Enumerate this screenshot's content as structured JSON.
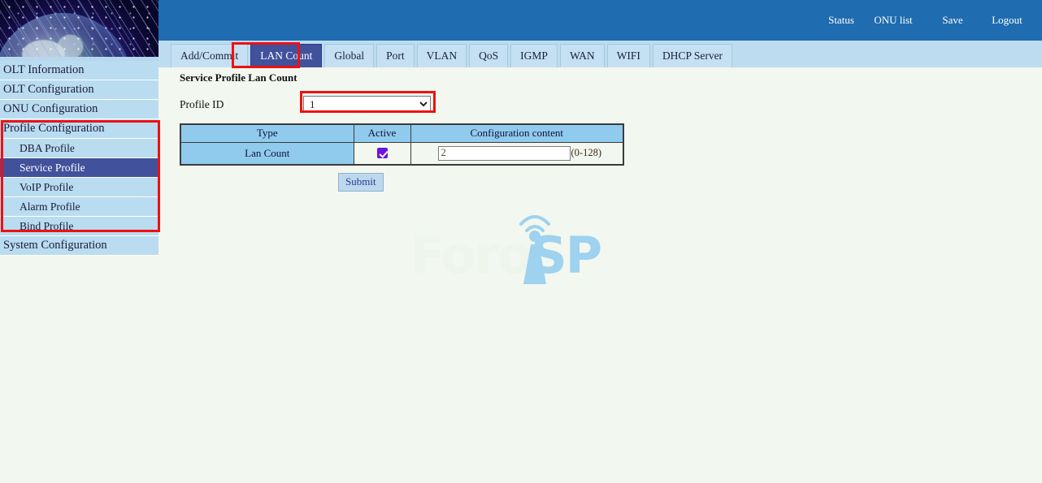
{
  "sidebar": {
    "banner_alt": "globe-fiber-banner",
    "items": [
      {
        "label": "OLT Information",
        "level": "top",
        "active": false
      },
      {
        "label": "OLT Configuration",
        "level": "top",
        "active": false
      },
      {
        "label": "ONU Configuration",
        "level": "top",
        "active": false
      },
      {
        "label": "Profile Configuration",
        "level": "top",
        "active": false
      },
      {
        "label": "DBA Profile",
        "level": "sub",
        "active": false
      },
      {
        "label": "Service Profile",
        "level": "sub",
        "active": true
      },
      {
        "label": "VoIP Profile",
        "level": "sub",
        "active": false
      },
      {
        "label": "Alarm Profile",
        "level": "sub",
        "active": false
      },
      {
        "label": "Bind Profile",
        "level": "sub",
        "active": false
      },
      {
        "label": "System Configuration",
        "level": "top",
        "active": false
      }
    ]
  },
  "topnav": {
    "items": [
      {
        "label": "Status"
      },
      {
        "label": "ONU list"
      },
      {
        "label": "Save"
      },
      {
        "label": "Logout"
      }
    ]
  },
  "tabs": [
    {
      "label": "Add/Commit",
      "active": false
    },
    {
      "label": "LAN Count",
      "active": true
    },
    {
      "label": "Global",
      "active": false
    },
    {
      "label": "Port",
      "active": false
    },
    {
      "label": "VLAN",
      "active": false
    },
    {
      "label": "QoS",
      "active": false
    },
    {
      "label": "IGMP",
      "active": false
    },
    {
      "label": "WAN",
      "active": false
    },
    {
      "label": "WIFI",
      "active": false
    },
    {
      "label": "DHCP Server",
      "active": false
    }
  ],
  "main": {
    "page_title": "Service Profile Lan Count",
    "profile_id_label": "Profile ID",
    "profile_id_value": "1",
    "profile_id_options": [
      "1"
    ],
    "table": {
      "headers": [
        "Type",
        "Active",
        "Configuration content"
      ],
      "rows": [
        {
          "type": "Lan Count",
          "active_checked": true,
          "value": "2",
          "range_hint": "(0-128)"
        }
      ]
    },
    "submit_label": "Submit"
  },
  "watermark": {
    "text_left": "Foro",
    "text_right": "SP",
    "tower_letter": "i"
  },
  "colors": {
    "header_blue": "#1f6cb0",
    "tabbar_blue": "#bddcf0",
    "active_navy": "#41519c",
    "sidebar_blue": "#badcf0",
    "table_header_blue": "#90cbee",
    "page_bg": "#f2f7ef",
    "annotation_red": "#ee1111",
    "checkbox_purple": "#6c14e0",
    "watermark_blue": "#9ed2ee"
  }
}
